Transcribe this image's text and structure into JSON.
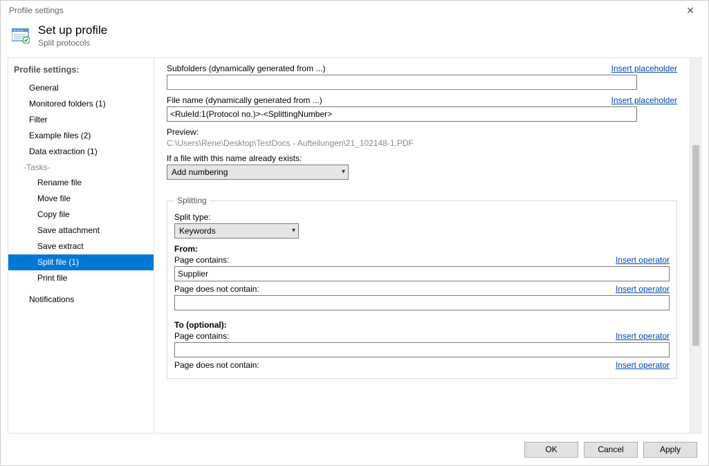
{
  "titlebar": "Profile settings",
  "header": {
    "title": "Set up profile",
    "subtitle": "Split protocols"
  },
  "sidebar": {
    "title": "Profile settings:",
    "items": {
      "general": "General",
      "monitored": "Monitored folders (1)",
      "filter": "Filter",
      "examples": "Example files (2)",
      "extract": "Data extraction (1)",
      "tasks_group": "-Tasks-",
      "rename": "Rename file",
      "move": "Move file",
      "copy": "Copy file",
      "saveatt": "Save attachment",
      "saveext": "Save extract",
      "split": "Split file (1)",
      "print": "Print file",
      "notif": "Notifications"
    }
  },
  "content": {
    "subfolders_label": "Subfolders (dynamically generated from ...)",
    "subfolders_value": "",
    "insert_placeholder": "Insert placeholder",
    "filename_label": "File name (dynamically generated from ...)",
    "filename_value": "<RuleId:1(Protocol no.)>-<SplittingNumber>",
    "preview_label": "Preview:",
    "preview_value": "C:\\Users\\Rene\\Desktop\\TestDocs - Aufteilungen\\21_102148-1.PDF",
    "exists_label": "If a file with this name already exists:",
    "exists_value": "Add numbering",
    "splitting_legend": "Splitting",
    "split_type_label": "Split type:",
    "split_type_value": "Keywords",
    "from_label": "From:",
    "page_contains_label": "Page contains:",
    "page_contains_value1": "Supplier",
    "page_notcontain_label": "Page does not contain:",
    "page_notcontain_value1": "",
    "to_label": "To (optional):",
    "page_contains_value2": "",
    "insert_operator": "Insert operator"
  },
  "footer": {
    "ok": "OK",
    "cancel": "Cancel",
    "apply": "Apply"
  }
}
